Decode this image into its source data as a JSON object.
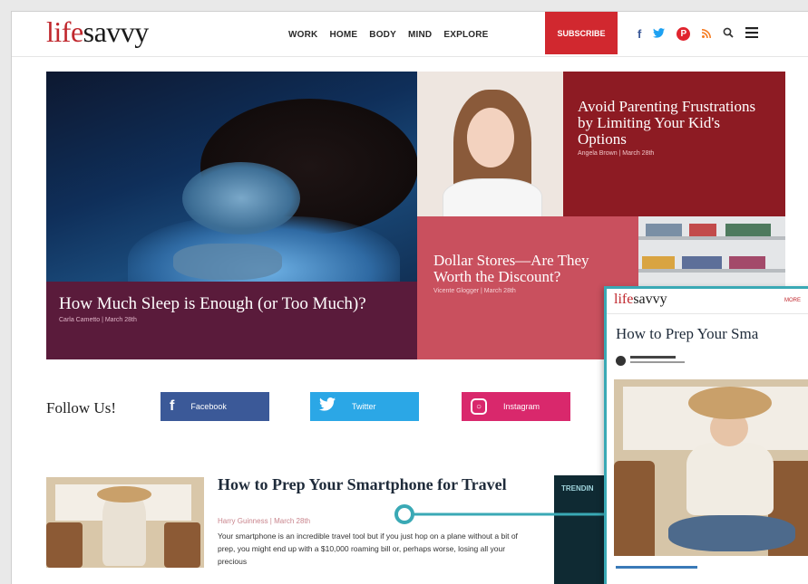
{
  "brand": {
    "logo_part1": "life",
    "logo_part2": "savvy"
  },
  "nav": {
    "items": [
      "WORK",
      "HOME",
      "BODY",
      "MIND",
      "EXPLORE"
    ],
    "subscribe": "SUBSCRIBE"
  },
  "header_icons": [
    "facebook-icon",
    "twitter-icon",
    "pinterest-icon",
    "rss-icon",
    "search-icon",
    "menu-icon"
  ],
  "hero": {
    "main": {
      "title": "How Much Sleep is Enough (or Too Much)?",
      "meta": "Carla Cametto | March 28th"
    },
    "parenting": {
      "title": "Avoid Parenting Frustrations by Limiting Your Kid's Options",
      "meta": "Angela Brown | March 28th"
    },
    "dollar": {
      "title": "Dollar Stores—Are They Worth the Discount?",
      "meta": "Vicente Glogger | March 28th"
    }
  },
  "follow": {
    "label": "Follow Us!",
    "facebook": "Facebook",
    "twitter": "Twitter",
    "instagram": "Instagram"
  },
  "article": {
    "title": "How to Prep Your Smartphone for Travel",
    "meta": "Harry Guinness | March 28th",
    "excerpt": "Your smartphone is an incredible travel tool but if you just hop on a plane without a bit of prep, you might end up with a $10,000 roaming bill or, perhaps worse, losing all your precious"
  },
  "trending": {
    "label": "TRENDIN"
  },
  "phone": {
    "logo_part1": "life",
    "logo_part2": "savvy",
    "menu": "MORE",
    "title": "How to Prep Your Sma"
  },
  "colors": {
    "brand_red": "#c0272d",
    "accent_teal": "#3aa9b5",
    "facebook": "#3b5998",
    "twitter": "#2ba7e6",
    "instagram": "#d9286c"
  }
}
